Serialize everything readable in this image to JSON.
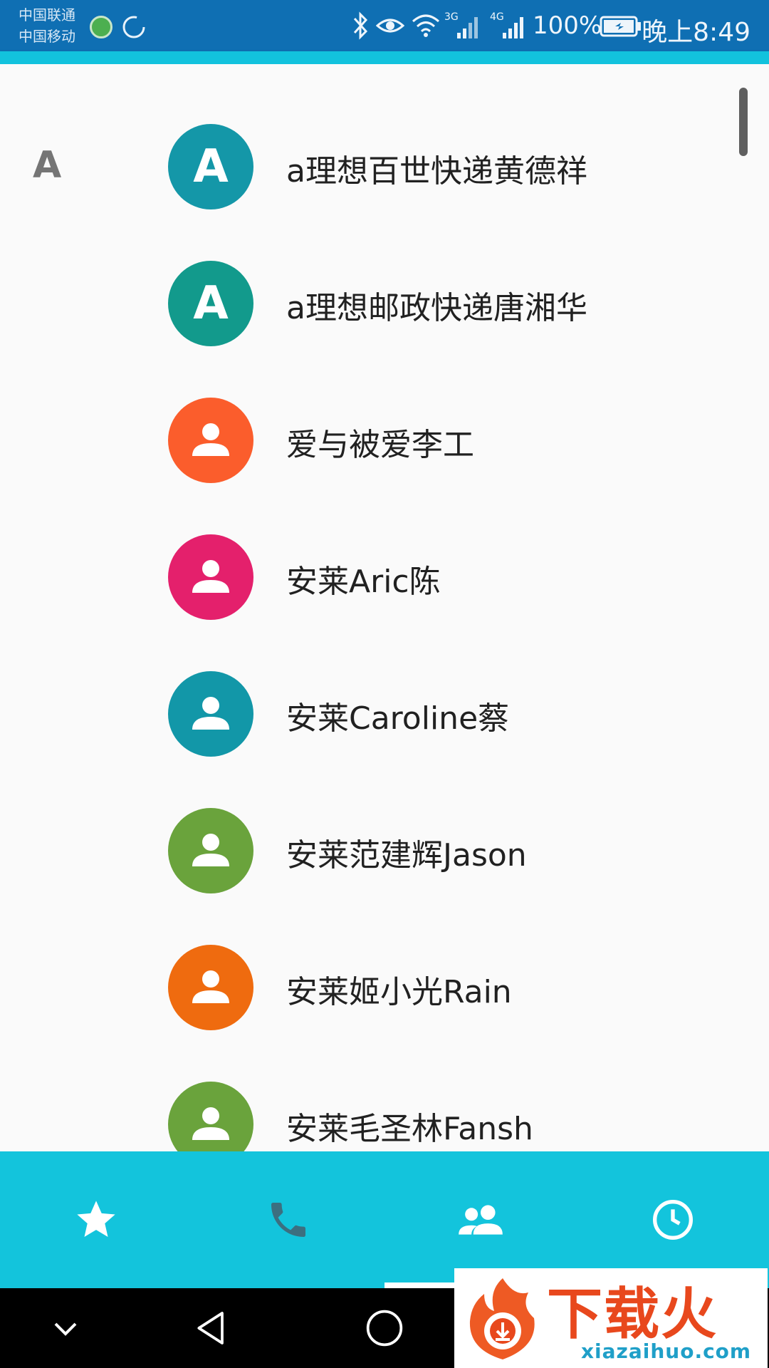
{
  "status_bar": {
    "carrier_1": "中国联通",
    "carrier_2": "中国移动",
    "network_3g": "3G",
    "network_4g": "4G",
    "battery": "100%",
    "time": "晚上8:49"
  },
  "contacts": {
    "section": "A",
    "items": [
      {
        "name": "a理想百世快递黄德祥",
        "initial": "A",
        "avatar": "letter",
        "color": "#1497a8"
      },
      {
        "name": "a理想邮政快递唐湘华",
        "initial": "A",
        "avatar": "letter",
        "color": "#129a8c"
      },
      {
        "name": "爱与被爱李工",
        "initial": "",
        "avatar": "person-icon",
        "color": "#fb5d2c"
      },
      {
        "name": "安莱Aric陈",
        "initial": "",
        "avatar": "person-icon",
        "color": "#e4206c"
      },
      {
        "name": "安莱Caroline蔡",
        "initial": "",
        "avatar": "person-icon",
        "color": "#1297a8"
      },
      {
        "name": "安莱范建辉Jason",
        "initial": "",
        "avatar": "person-icon",
        "color": "#6aa33c"
      },
      {
        "name": "安莱姬小光Rain",
        "initial": "",
        "avatar": "person-icon",
        "color": "#ef6b0f"
      },
      {
        "name": "安莱毛圣林Fansh",
        "initial": "",
        "avatar": "person-icon",
        "color": "#6aa33c"
      }
    ]
  },
  "tabs": [
    {
      "icon": "star-icon",
      "selected": false
    },
    {
      "icon": "phone-icon",
      "selected": false
    },
    {
      "icon": "contacts-icon",
      "selected": true
    },
    {
      "icon": "clock-icon",
      "selected": false
    }
  ],
  "nav": [
    "chevron-down-icon",
    "back-icon",
    "home-icon"
  ],
  "watermark": {
    "text": "下载火",
    "url": "xiazaihuo.com"
  },
  "colors": {
    "status_bar": "#0f6fb3",
    "accent": "#13c4dc",
    "background": "#fafafa"
  }
}
